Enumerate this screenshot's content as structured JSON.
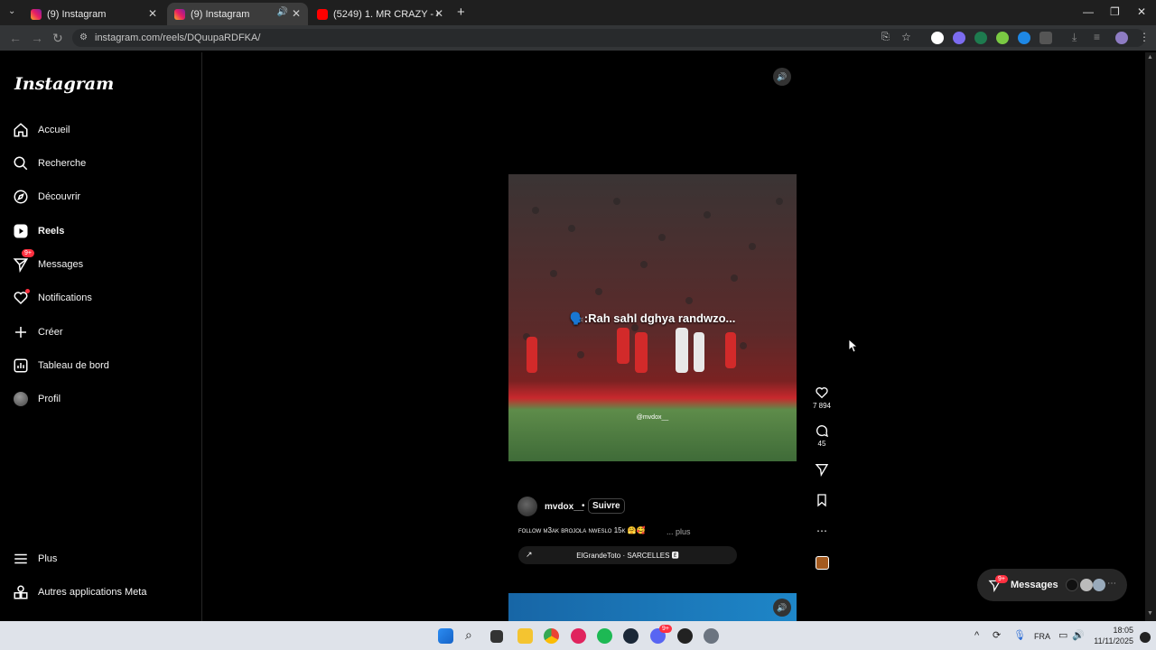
{
  "browser": {
    "tabs": [
      {
        "label": "(9) Instagram",
        "active": false
      },
      {
        "label": "(9) Instagram",
        "active": true
      },
      {
        "label": "(5249) 1. MR CRAZY - COMBAT",
        "active": false
      }
    ],
    "url": "instagram.com/reels/DQuupaRDFKA/"
  },
  "sidebar": {
    "logo": "Instagram",
    "items": [
      {
        "label": "Accueil",
        "icon": "home-icon"
      },
      {
        "label": "Recherche",
        "icon": "search-icon"
      },
      {
        "label": "Découvrir",
        "icon": "compass-icon"
      },
      {
        "label": "Reels",
        "icon": "reels-icon"
      },
      {
        "label": "Messages",
        "icon": "messenger-icon",
        "badge": "9+"
      },
      {
        "label": "Notifications",
        "icon": "heart-icon"
      },
      {
        "label": "Créer",
        "icon": "plus-icon"
      },
      {
        "label": "Tableau de bord",
        "icon": "dashboard-icon"
      },
      {
        "label": "Profil",
        "icon": "avatar-icon"
      }
    ],
    "bottom": [
      {
        "label": "Plus",
        "icon": "menu-icon"
      },
      {
        "label": "Autres applications Meta",
        "icon": "meta-apps-icon"
      }
    ]
  },
  "reel": {
    "overlay_caption": "🗣️:Rah sahl dghya randwzo...",
    "watermark": "@mvdox__",
    "likes": "7 894",
    "comments": "45",
    "username": "mvdox__",
    "follow_label": "Suivre",
    "description": "follow m3ak brojola nweslo 15k 🤗🥰",
    "more_label": "... plus",
    "audio": "ElGrandeToto · SARCELLES 🅴"
  },
  "messages_bubble": {
    "label": "Messages",
    "badge": "9+"
  },
  "taskbar": {
    "lang": "FRA",
    "time": "18:05",
    "date": "11/11/2025",
    "discord_badge": "9+"
  },
  "colors": {
    "accent_red": "#ff3040",
    "link_blue": "#0095f6"
  }
}
